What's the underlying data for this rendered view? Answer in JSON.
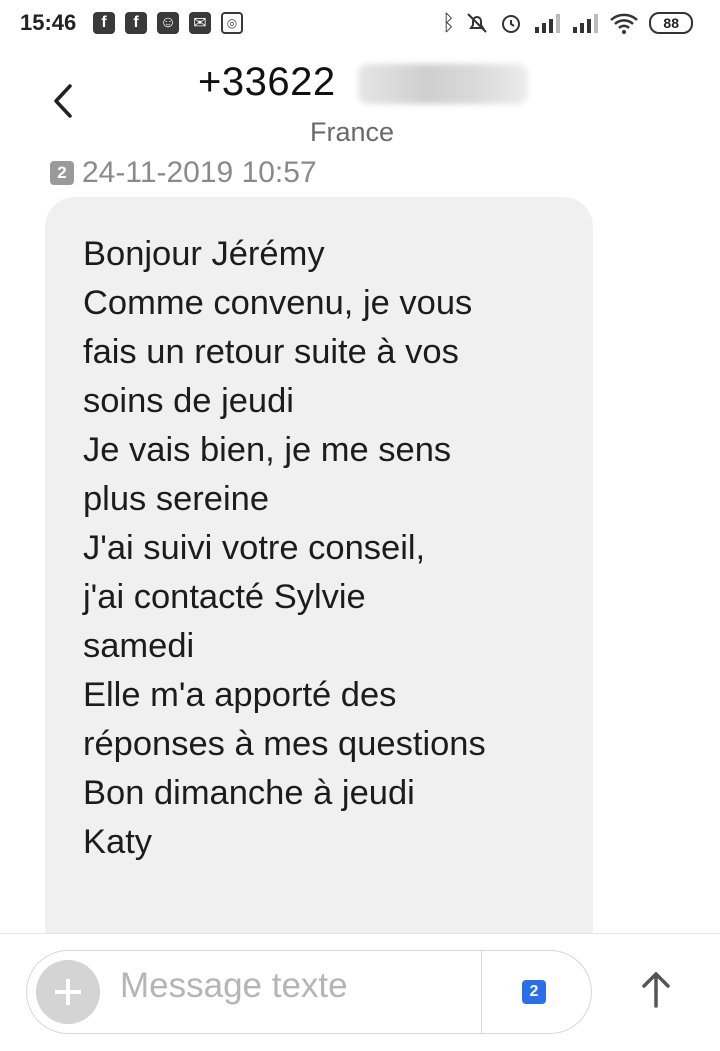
{
  "status_bar": {
    "time": "15:46",
    "left_icons": [
      "facebook-icon",
      "facebook-icon",
      "face-icon",
      "mail-icon",
      "instagram-icon"
    ],
    "right_icons": [
      "bluetooth-icon",
      "notifications-off-icon",
      "alarm-icon",
      "signal-icon",
      "signal-icon",
      "wifi-icon"
    ],
    "battery": "88"
  },
  "header": {
    "contact_number": "+33622",
    "country": "France"
  },
  "conversation": {
    "sim_slot": "2",
    "timestamp": "24-11-2019 10:57",
    "message_lines": [
      "Bonjour Jérémy",
      "Comme convenu, je vous",
      "fais un retour suite à vos",
      "soins de jeudi",
      "Je vais bien, je me sens",
      "plus sereine",
      "J'ai suivi votre conseil,",
      "j'ai contacté Sylvie",
      "samedi",
      "Elle m'a apporté des",
      "réponses à mes questions",
      "Bon dimanche à jeudi",
      "Katy"
    ]
  },
  "composer": {
    "placeholder": "Message texte",
    "sim_slot": "2"
  }
}
